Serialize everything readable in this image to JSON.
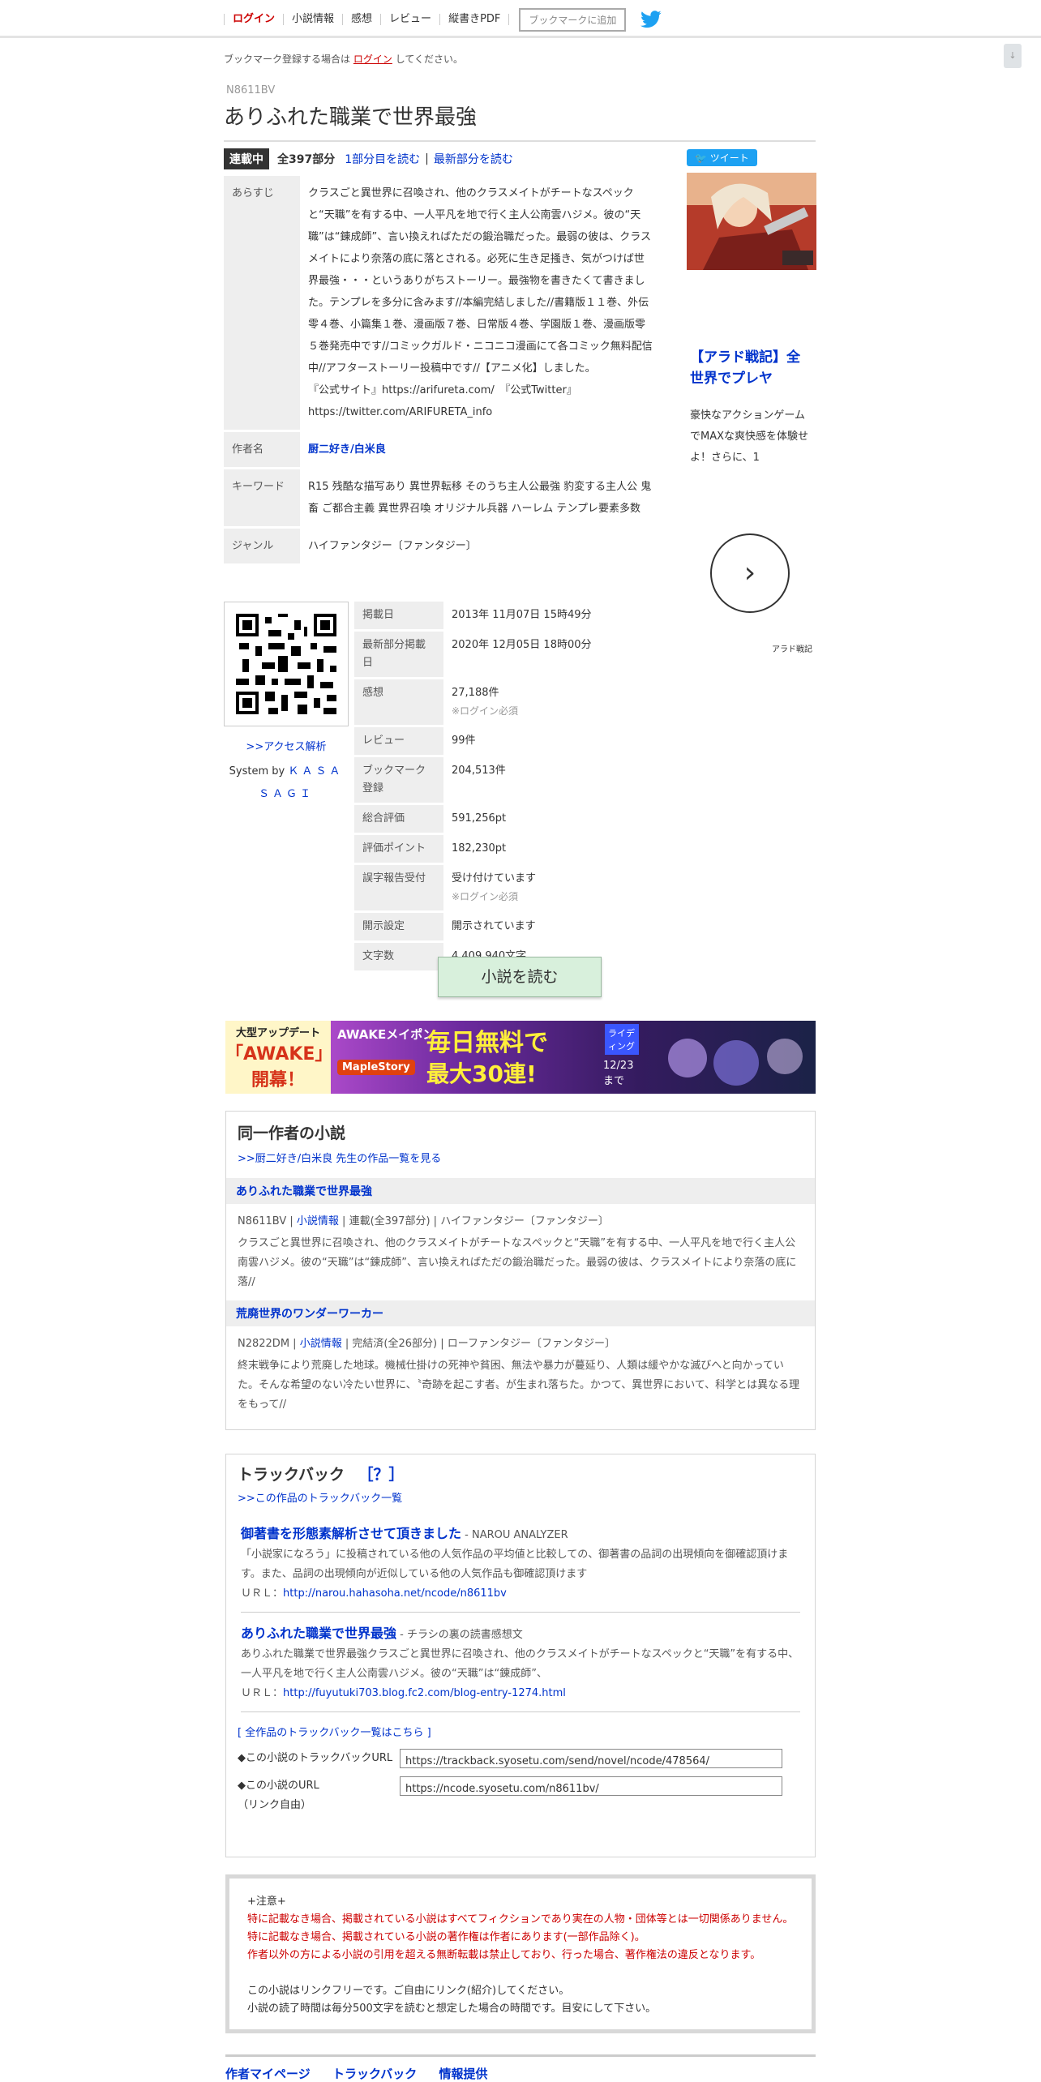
{
  "nav": {
    "items": [
      "ログイン",
      "小説情報",
      "感想",
      "レビュー",
      "縦書きPDF"
    ],
    "bookmark_button": "ブックマークに追加",
    "icon": "twitter-bird-icon"
  },
  "scroll_top": "↓",
  "notice": {
    "prefix": "ブックマーク登録する場合は",
    "link": "ログイン",
    "suffix": "してください。"
  },
  "novel": {
    "ncode": "N8611BV",
    "title": "ありふれた職業で世界最強",
    "status": "連載中",
    "count": "全397部分",
    "read_first": "1部分目を読む",
    "read_latest": "最新部分を読む"
  },
  "info": {
    "synopsis_label": "あらすじ",
    "synopsis": "クラスごと異世界に召喚され、他のクラスメイトがチートなスペックと“天職”を有する中、一人平凡を地で行く主人公南雲ハジメ。彼の“天職”は“錬成師”、言い換えればただの鍛治職だった。最弱の彼は、クラスメイトにより奈落の底に落とされる。必死に生き足掻き、気がつけば世界最強・・・というありがちストーリー。最強物を書きたくて書きました。テンプレを多分に含みます//本編完結しました//書籍版１１巻、外伝零４巻、小篇集１巻、漫画版７巻、日常版４巻、学園版１巻、漫画版零５巻発売中です//コミックガルド・ニコニコ漫画にて各コミック無料配信中//アフターストーリー投稿中です//【アニメ化】しました。",
    "official_site": "『公式サイト』https://arifureta.com/　『公式Twitter』https://twitter.com/ARIFURETA_info",
    "author_label": "作者名",
    "author": "厨二好き/白米良",
    "keyword_label": "キーワード",
    "keywords": "R15 残酷な描写あり 異世界転移  そのうち主人公最強 豹変する主人公 鬼畜 ご都合主義 異世界召喚 オリジナル兵器 ハーレム テンプレ要素多数",
    "genre_label": "ジャンル",
    "genre": "ハイファンタジー〔ファンタジー〕"
  },
  "qr": {
    "access_link": ">>アクセス解析",
    "system_prefix": "System by",
    "system_name": "ＫＡＳＡＳＡＧＩ"
  },
  "stats": [
    {
      "label": "掲載日",
      "value": "2013年 11月07日 15時49分",
      "note": ""
    },
    {
      "label": "最新部分掲載日",
      "value": "2020年 12月05日 18時00分",
      "note": ""
    },
    {
      "label": "感想",
      "value": "27,188件",
      "note": "※ログイン必須"
    },
    {
      "label": "レビュー",
      "value": "99件",
      "note": ""
    },
    {
      "label": "ブックマーク登録",
      "value": "204,513件",
      "note": ""
    },
    {
      "label": "総合評価",
      "value": "591,256pt",
      "note": ""
    },
    {
      "label": "評価ポイント",
      "value": "182,230pt",
      "note": ""
    },
    {
      "label": "誤字報告受付",
      "value": "受け付けています",
      "note": "※ログイン必須"
    },
    {
      "label": "開示設定",
      "value": "開示されています",
      "note": ""
    },
    {
      "label": "文字数",
      "value": "4,409,940文字",
      "note": ""
    }
  ],
  "sidebar": {
    "tweet": "ツイート",
    "ad_title": "【アラド戦記】全世界でプレヤ",
    "ad_text": "豪快なアクションゲームでMAXな爽快感を体験せよ！さらに、1",
    "ad_next": "›",
    "ad_source": "アラド戦記"
  },
  "read_button": "小説を読む",
  "banner": {
    "left_line1": "大型アップデート",
    "left_line2": "「AWAKE」",
    "left_line3": "開幕！",
    "mid_line1": "AWAKEメイポン",
    "mid_big1": "毎日無料で",
    "mid_big2": "最大30連!",
    "logo": "MapleStory",
    "badge": "ライディング",
    "date": "12/23まで"
  },
  "same_author": {
    "heading": "同一作者の小説",
    "all_works_link": ">>厨二好き/白米良 先生の作品一覧を見る",
    "works": [
      {
        "title": "ありふれた職業で世界最強",
        "ncode": "N8611BV",
        "info_link": "小説情報",
        "status": "連載(全397部分)",
        "genre": "ハイファンタジー〔ファンタジー〕",
        "desc": "クラスごと異世界に召喚され、他のクラスメイトがチートなスペックと“天職”を有する中、一人平凡を地で行く主人公南雲ハジメ。彼の“天職”は“錬成師”、言い換えればただの鍛治職だった。最弱の彼は、クラスメイトにより奈落の底に落//"
      },
      {
        "title": "荒廃世界のワンダーワーカー",
        "ncode": "N2822DM",
        "info_link": "小説情報",
        "status": "完結済(全26部分)",
        "genre": "ローファンタジー〔ファンタジー〕",
        "desc": "終末戦争により荒廃した地球。機械仕掛けの死神や貧困、無法や暴力が蔓延り、人類は緩やかな滅びへと向かっていた。そんな希望のない冷たい世界に、〝奇跡を起こす者〟が生まれ落ちた。かつて、異世界において、科学とは異なる理をもって//"
      }
    ]
  },
  "trackback": {
    "heading": "トラックバック",
    "help": "［？］",
    "list_link": ">>この作品のトラックバック一覧",
    "items": [
      {
        "title": "御著書を形態素解析させて頂きました",
        "source": " - NAROU ANALYZER",
        "desc": "「小説家になろう」に投稿されている他の人気作品の平均値と比較しての、御著書の品詞の出現傾向を御確認頂けます。また、品詞の出現傾向が近似している他の人気作品も御確認頂けます",
        "url_label": "ＵＲＬ：",
        "url": "http://narou.hahasoha.net/ncode/n8611bv"
      },
      {
        "title": "ありふれた職業で世界最強",
        "source": " - チラシの裏の読書感想文",
        "desc": "ありふれた職業で世界最強クラスごと異世界に召喚され、他のクラスメイトがチートなスペックと“天職”を有する中、一人平凡を地で行く主人公南雲ハジメ。彼の“天職”は“錬成師”、",
        "url_label": "ＵＲＬ：",
        "url": "http://fuyutuki703.blog.fc2.com/blog-entry-1274.html"
      }
    ],
    "all_link": "[ 全作品のトラックバック一覧はこちら ]",
    "tb_url_label": "◆この小説のトラックバックURL",
    "tb_url": "https://trackback.syosetu.com/send/novel/ncode/478564/",
    "novel_url_label": "◆この小説のURL",
    "novel_url_sub": "（リンク自由）",
    "novel_url": "https://ncode.syosetu.com/n8611bv/"
  },
  "caution": {
    "head": "+注意+",
    "line1": "特に記載なき場合、掲載されている小説はすべてフィクションであり実在の人物・団体等とは一切関係ありません。",
    "line2": "特に記載なき場合、掲載されている小説の著作権は作者にあります(一部作品除く)。",
    "line3": "作者以外の方による小説の引用を超える無断転載は禁止しており、行った場合、著作権法の違反となります。",
    "line4": "この小説はリンクフリーです。ご自由にリンク(紹介)してください。",
    "line5": "小説の読了時間は毎分500文字を読むと想定した場合の時間です。目安にして下さい。"
  },
  "footer": [
    "作者マイページ",
    "トラックバック",
    "情報提供"
  ]
}
